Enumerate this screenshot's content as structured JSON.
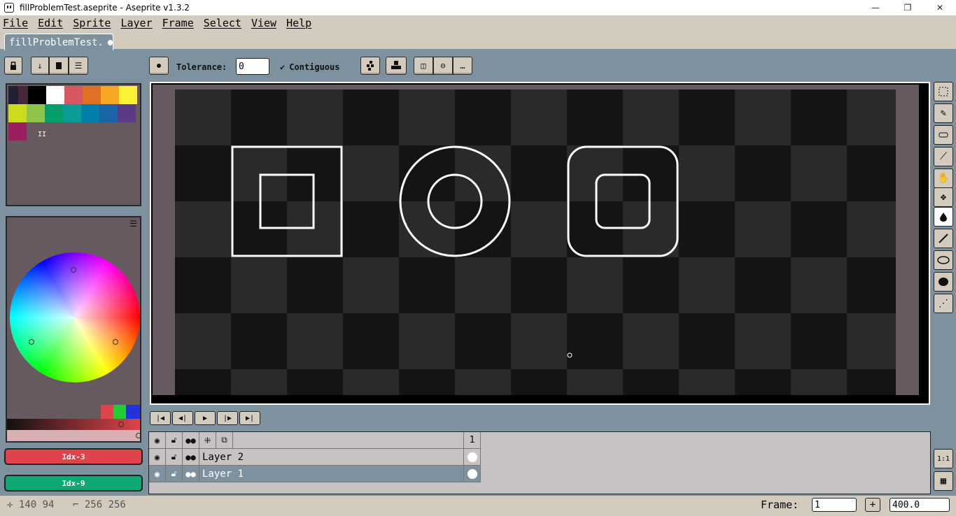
{
  "window": {
    "title": "fillProblemTest.aseprite - Aseprite v1.3.2",
    "minimize": "—",
    "maximize": "❐",
    "close": "✕"
  },
  "menu": [
    "File",
    "Edit",
    "Sprite",
    "Layer",
    "Frame",
    "Select",
    "View",
    "Help"
  ],
  "tab": {
    "label": "fillProblemTest."
  },
  "toolbar": {
    "tolerance_label": "Tolerance:",
    "tolerance_value": "0",
    "contiguous_label": "Contiguous",
    "contiguous_checked": true
  },
  "palette": {
    "colors": [
      "#222034",
      "#45283c",
      "#000000",
      "#ffffff",
      "#d95763",
      "#df7126",
      "#f5a623",
      "#fbf236",
      "#cbdb1e",
      "#8fc44a",
      "#079e6b",
      "#0c9c96",
      "#0080a8",
      "#1a64a8",
      "#5b3a88",
      "#9b1e5e"
    ],
    "marker": "II"
  },
  "colors": {
    "foreground_label": "Idx-3",
    "foreground": "#e0444a",
    "background_label": "Idx-9",
    "background": "#0da874",
    "accent": "#7d929e",
    "panel": "#675960",
    "chrome": "#d3cbbe"
  },
  "timeline": {
    "frame_header": "1",
    "layers": [
      {
        "name": "Layer 2",
        "selected": false
      },
      {
        "name": "Layer 1",
        "selected": true
      }
    ]
  },
  "status": {
    "position": "140  94",
    "size": "256  256",
    "frame_label": "Frame:",
    "frame_value": "1",
    "zoom_value": "400.0"
  },
  "tools": [
    "rect-marquee-icon",
    "pencil-icon",
    "eraser-icon",
    "eyedropper-icon",
    "hand-icon",
    "move-icon",
    "paint-bucket-icon",
    "line-icon",
    "ellipse-icon",
    "blur-icon",
    "spray-icon"
  ],
  "misc": {
    "ratio_label": "1:1",
    "add_frame": "+"
  }
}
